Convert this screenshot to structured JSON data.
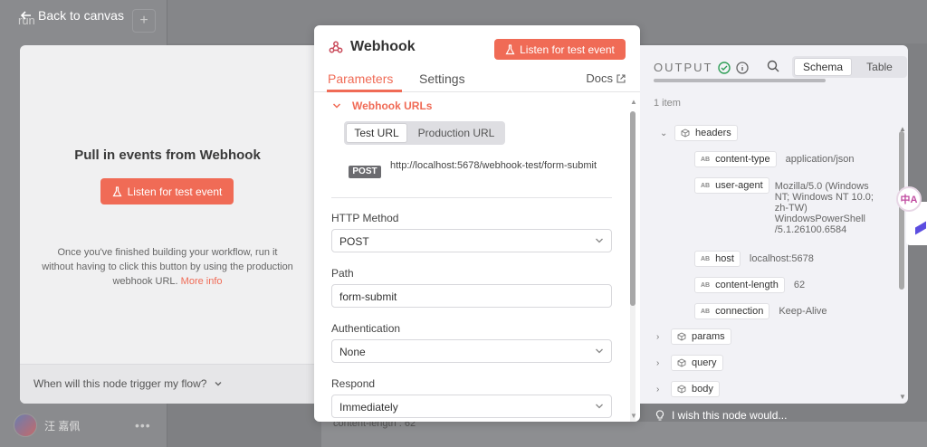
{
  "top": {
    "back_label": "Back to canvas",
    "bg_run_label": "run"
  },
  "left": {
    "title": "Pull in events from Webhook",
    "listen_label": "Listen for test event",
    "desc": "Once you've finished building your workflow, run it without having to click this button by using the production webhook URL.",
    "more_info": "More info",
    "footer": "When will this node trigger my flow?"
  },
  "modal": {
    "title": "Webhook",
    "listen_label": "Listen for test event",
    "tabs": [
      {
        "label": "Parameters"
      },
      {
        "label": "Settings"
      }
    ],
    "docs_label": "Docs",
    "webhook_urls_label": "Webhook URLs",
    "url_options": [
      {
        "label": "Test URL"
      },
      {
        "label": "Production URL"
      }
    ],
    "method_badge": "POST",
    "url": "http://localhost:5678/webhook-test/form-submit",
    "fields": [
      {
        "label": "HTTP Method",
        "value": "POST"
      },
      {
        "label": "Path",
        "value": "form-submit"
      },
      {
        "label": "Authentication",
        "value": "None"
      },
      {
        "label": "Respond",
        "value": "Immediately"
      }
    ]
  },
  "output": {
    "title": "OUTPUT",
    "view_options": [
      {
        "label": "Schema"
      },
      {
        "label": "Table"
      }
    ],
    "count": "1 item",
    "tree": {
      "headers": "headers",
      "fields": [
        {
          "key": "content-type",
          "value": "application/json"
        },
        {
          "key": "user-agent",
          "value": "Mozilla/5.0 (Windows NT; Windows NT 10.0; zh-TW) WindowsPowerShell /5.1.26100.6584"
        },
        {
          "key": "host",
          "value": "localhost:5678"
        },
        {
          "key": "content-length",
          "value": "62"
        },
        {
          "key": "connection",
          "value": "Keep-Alive"
        }
      ],
      "objects": [
        {
          "label": "params"
        },
        {
          "label": "query"
        },
        {
          "label": "body"
        }
      ]
    }
  },
  "wish_label": "I wish this node would...",
  "bottom": {
    "user_name": "汪 嘉佩",
    "bg_text": "content-length : 62"
  },
  "translate_label": "中A",
  "colors": {
    "accent": "#f06b56",
    "success": "#2e9e56"
  }
}
